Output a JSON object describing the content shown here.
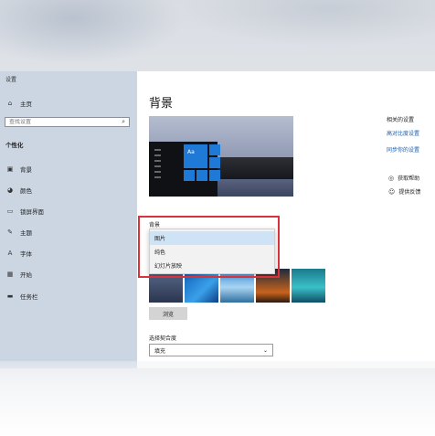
{
  "sidebar": {
    "app_title": "设置",
    "home": {
      "label": "主页",
      "icon": "home-icon"
    },
    "search": {
      "placeholder": "查找设置",
      "icon": "search-icon"
    },
    "section": "个性化",
    "items": [
      {
        "label": "背景",
        "icon": "image-icon"
      },
      {
        "label": "颜色",
        "icon": "palette-icon"
      },
      {
        "label": "锁屏界面",
        "icon": "lock-screen-icon"
      },
      {
        "label": "主题",
        "icon": "brush-icon"
      },
      {
        "label": "字体",
        "icon": "font-icon"
      },
      {
        "label": "开始",
        "icon": "start-menu-icon"
      },
      {
        "label": "任务栏",
        "icon": "taskbar-icon"
      }
    ]
  },
  "main": {
    "title": "背景",
    "preview_tile_text": "Aa",
    "background_label": "背景",
    "background_options": [
      "图片",
      "纯色",
      "幻灯片放映"
    ],
    "background_selected": "图片",
    "browse_label": "浏览",
    "fit_label": "选择契合度",
    "fit_value": "填充"
  },
  "related": {
    "header": "相关的设置",
    "links": [
      "高对比度设置",
      "同步你的设置"
    ]
  },
  "help": {
    "get_help": "获取帮助",
    "feedback": "提供反馈"
  },
  "colors": {
    "accent": "#1e7ad6",
    "link": "#1a5fb4",
    "highlight_border": "#d8323c",
    "sidebar_bg": "#ccd6e2"
  }
}
